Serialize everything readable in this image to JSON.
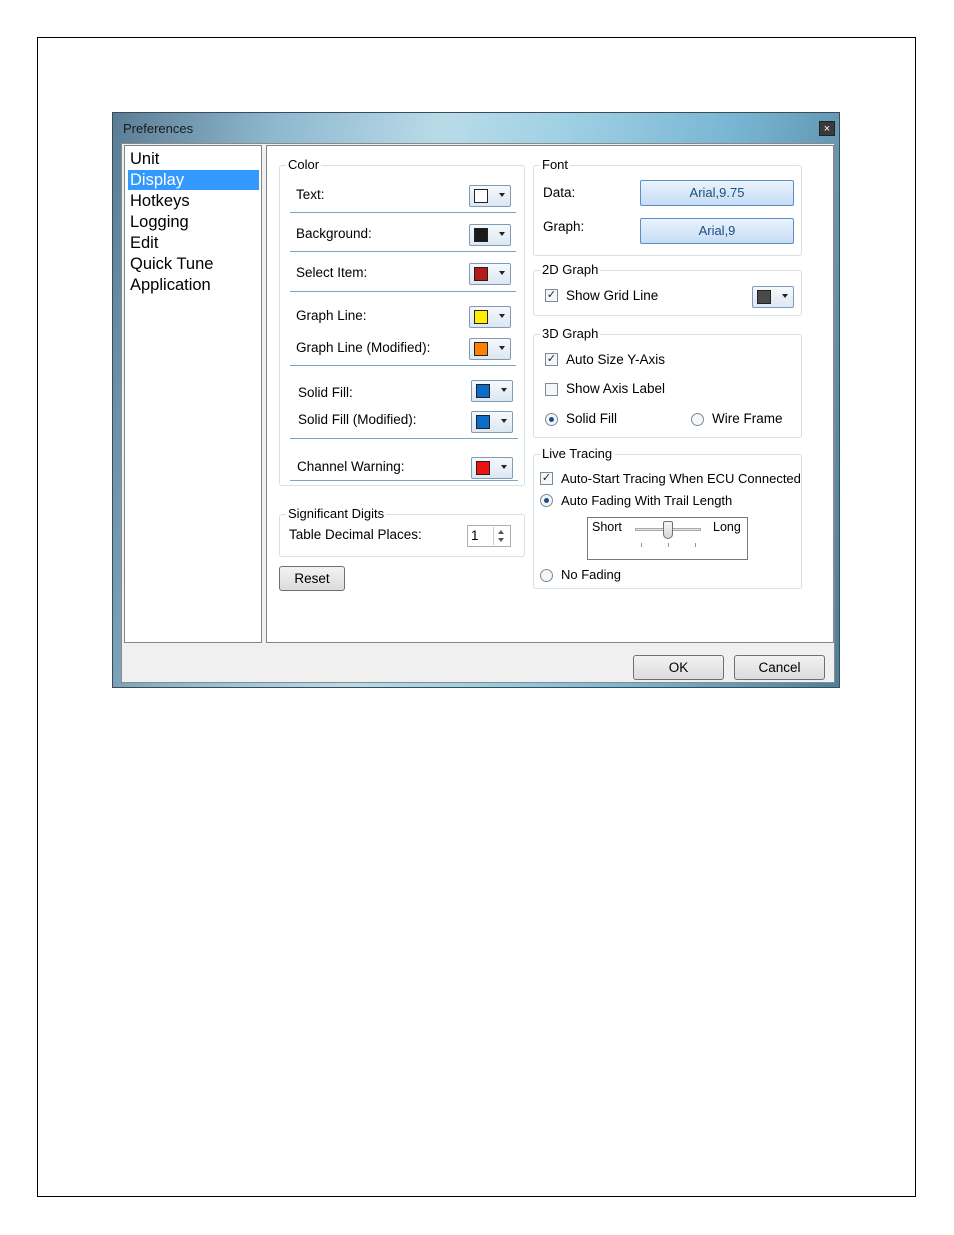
{
  "window": {
    "title": "Preferences",
    "close_glyph": "×"
  },
  "nav": {
    "items": [
      {
        "label": "Unit",
        "selected": false
      },
      {
        "label": "Display",
        "selected": true
      },
      {
        "label": "Hotkeys",
        "selected": false
      },
      {
        "label": "Logging",
        "selected": false
      },
      {
        "label": "Edit",
        "selected": false
      },
      {
        "label": "Quick Tune",
        "selected": false
      },
      {
        "label": "Application",
        "selected": false
      }
    ]
  },
  "color_group": {
    "title": "Color",
    "items": [
      {
        "label": "Text:",
        "color": "#ffffff",
        "icon": "chevron-down-icon"
      },
      {
        "label": "Background:",
        "color": "#1a1a1a",
        "icon": "chevron-down-icon"
      },
      {
        "label": "Select Item:",
        "color": "#b31b1b",
        "icon": "chevron-down-icon"
      },
      {
        "label": "Graph Line:",
        "color": "#ffee00",
        "icon": "chevron-down-icon"
      },
      {
        "label": "Graph Line (Modified):",
        "color": "#ff8000",
        "icon": "chevron-down-icon"
      },
      {
        "label": "Solid Fill:",
        "color": "#0a6ec8",
        "icon": "chevron-down-icon"
      },
      {
        "label": "Solid Fill (Modified):",
        "color": "#0a6ec8",
        "icon": "chevron-down-icon"
      },
      {
        "label": "Channel Warning:",
        "color": "#ee1111",
        "icon": "chevron-down-icon"
      }
    ]
  },
  "significant_digits": {
    "title": "Significant Digits",
    "label": "Table Decimal Places:",
    "value": "1"
  },
  "reset_label": "Reset",
  "font_group": {
    "title": "Font",
    "data_label": "Data:",
    "data_value": "Arial,9.75",
    "graph_label": "Graph:",
    "graph_value": "Arial,9"
  },
  "graph2d": {
    "title": "2D Graph",
    "show_grid_label": "Show Grid Line",
    "show_grid_checked": true,
    "grid_color": "#4a4a4a"
  },
  "graph3d": {
    "title": "3D Graph",
    "auto_size_label": "Auto Size Y-Axis",
    "auto_size_checked": true,
    "show_axis_label": "Show Axis Label",
    "show_axis_checked": false,
    "solid_fill_label": "Solid Fill",
    "wire_frame_label": "Wire Frame",
    "selected_mode": "Solid Fill"
  },
  "live_tracing": {
    "title": "Live Tracing",
    "auto_start_label": "Auto-Start Tracing When ECU Connected",
    "auto_start_checked": true,
    "auto_fading_label": "Auto Fading With Trail Length",
    "slider_short": "Short",
    "slider_long": "Long",
    "slider_level": 0.5,
    "no_fading_label": "No Fading",
    "selected_fading": "Auto Fading With Trail Length"
  },
  "dialog_buttons": {
    "ok": "OK",
    "cancel": "Cancel"
  },
  "check_glyph": "✓"
}
